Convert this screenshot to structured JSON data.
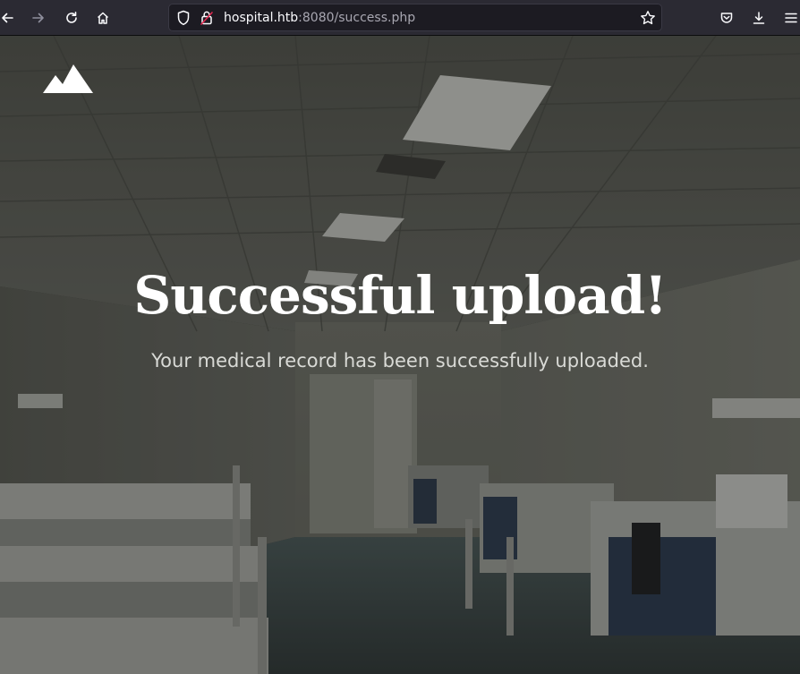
{
  "browser": {
    "url_host": "hospital.htb",
    "url_rest": ":8080/success.php",
    "icons": {
      "back": "arrow-left-icon",
      "forward": "arrow-right-icon",
      "reload": "reload-icon",
      "home": "home-icon",
      "tracking": "shield-icon",
      "security": "lock-icon",
      "bookmark": "star-icon",
      "pocket": "pocket-icon",
      "downloads": "download-icon",
      "menu": "hamburger-menu-icon"
    }
  },
  "page": {
    "logo_icon": "mountain-logo-icon",
    "title": "Successful upload!",
    "subtitle": "Your medical record has been successfully uploaded.",
    "colors": {
      "title": "#ffffff",
      "subtitle": "#d9dad6",
      "toolbar": "#2b2a33",
      "urlbar": "#1c1b22"
    }
  }
}
